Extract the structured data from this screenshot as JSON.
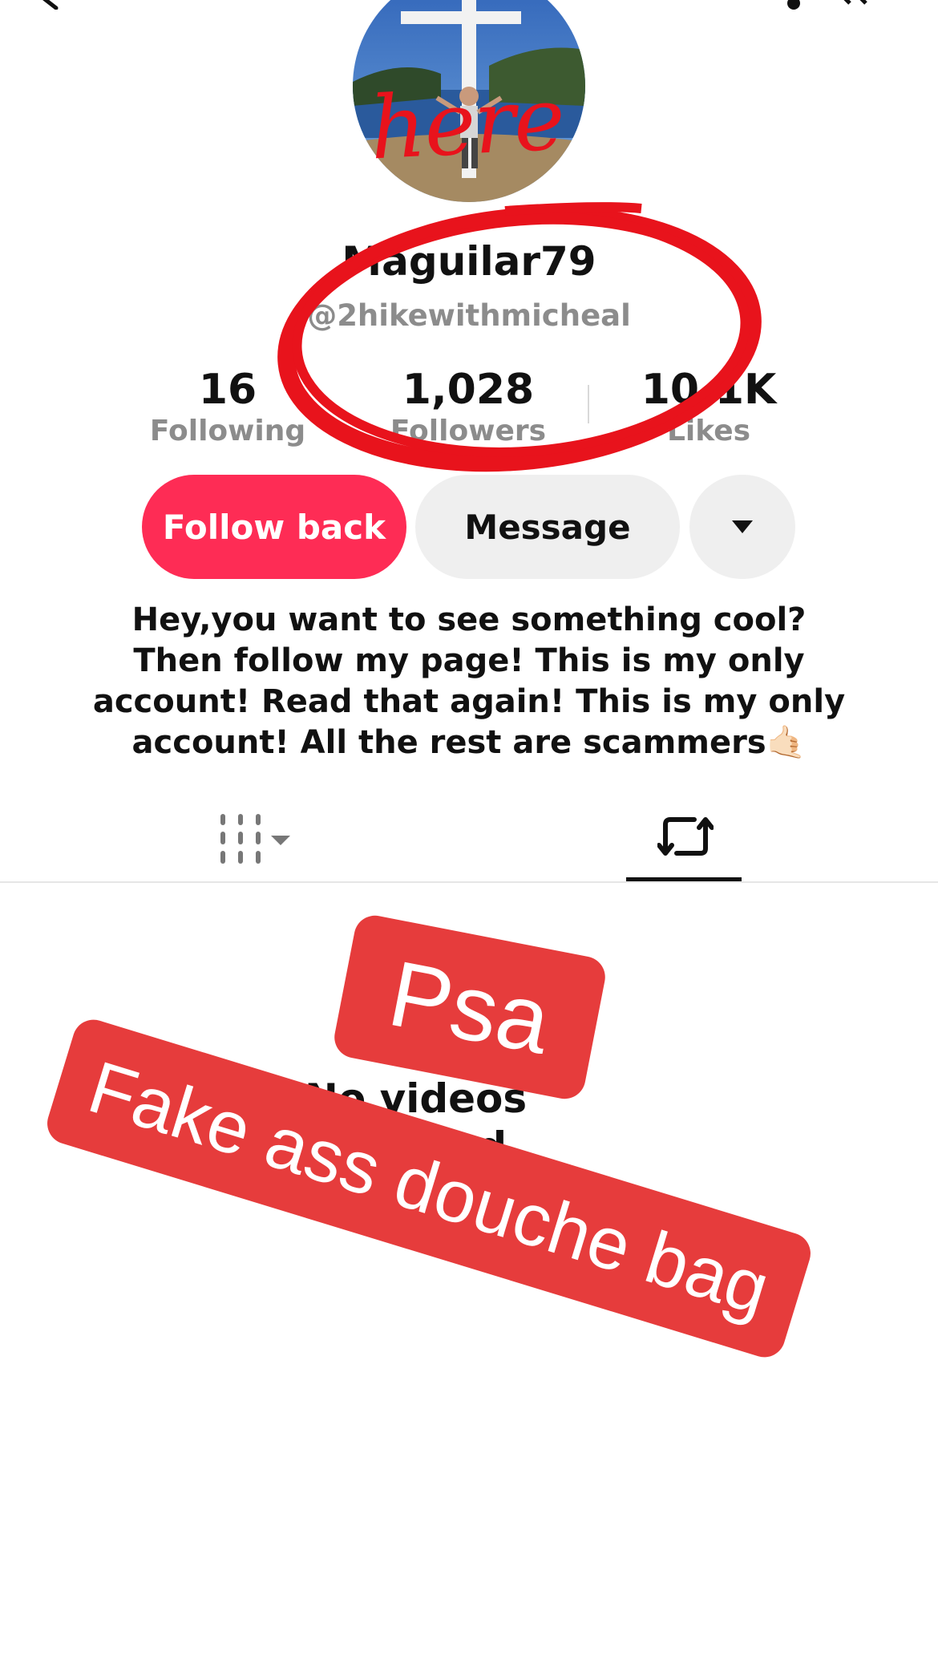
{
  "profile": {
    "display_name": "Maguilar79",
    "handle": "@2hikewithmicheal",
    "avatar": "avatar-photo-cross-ocean"
  },
  "stats": {
    "following": {
      "value": "16",
      "label": "Following"
    },
    "followers": {
      "value": "1,028",
      "label": "Followers"
    },
    "likes": {
      "value": "10.1K",
      "label": "Likes"
    }
  },
  "actions": {
    "follow_back": "Follow back",
    "message": "Message",
    "more_icon": "caret-down-icon"
  },
  "bio": "Hey,you want to see something cool? Then follow my page! This is my only account! Read that again! This is my only account! All the rest are scammers🤙🏻",
  "tabs": {
    "grid_icon": "grid-dropdown-icon",
    "repost_icon": "repost-icon",
    "active": "repost"
  },
  "empty_state": {
    "text": "No videos reposted"
  },
  "annotations": {
    "here_text": "here",
    "psa_sticker": "Psa",
    "fake_sticker": "Fake ass douche bag",
    "circle_color": "#e8131c",
    "sticker_color": "#e63c3c"
  },
  "colors": {
    "primary": "#fe2c55",
    "secondary_button": "#efefef",
    "muted_text": "#8c8c8c"
  }
}
